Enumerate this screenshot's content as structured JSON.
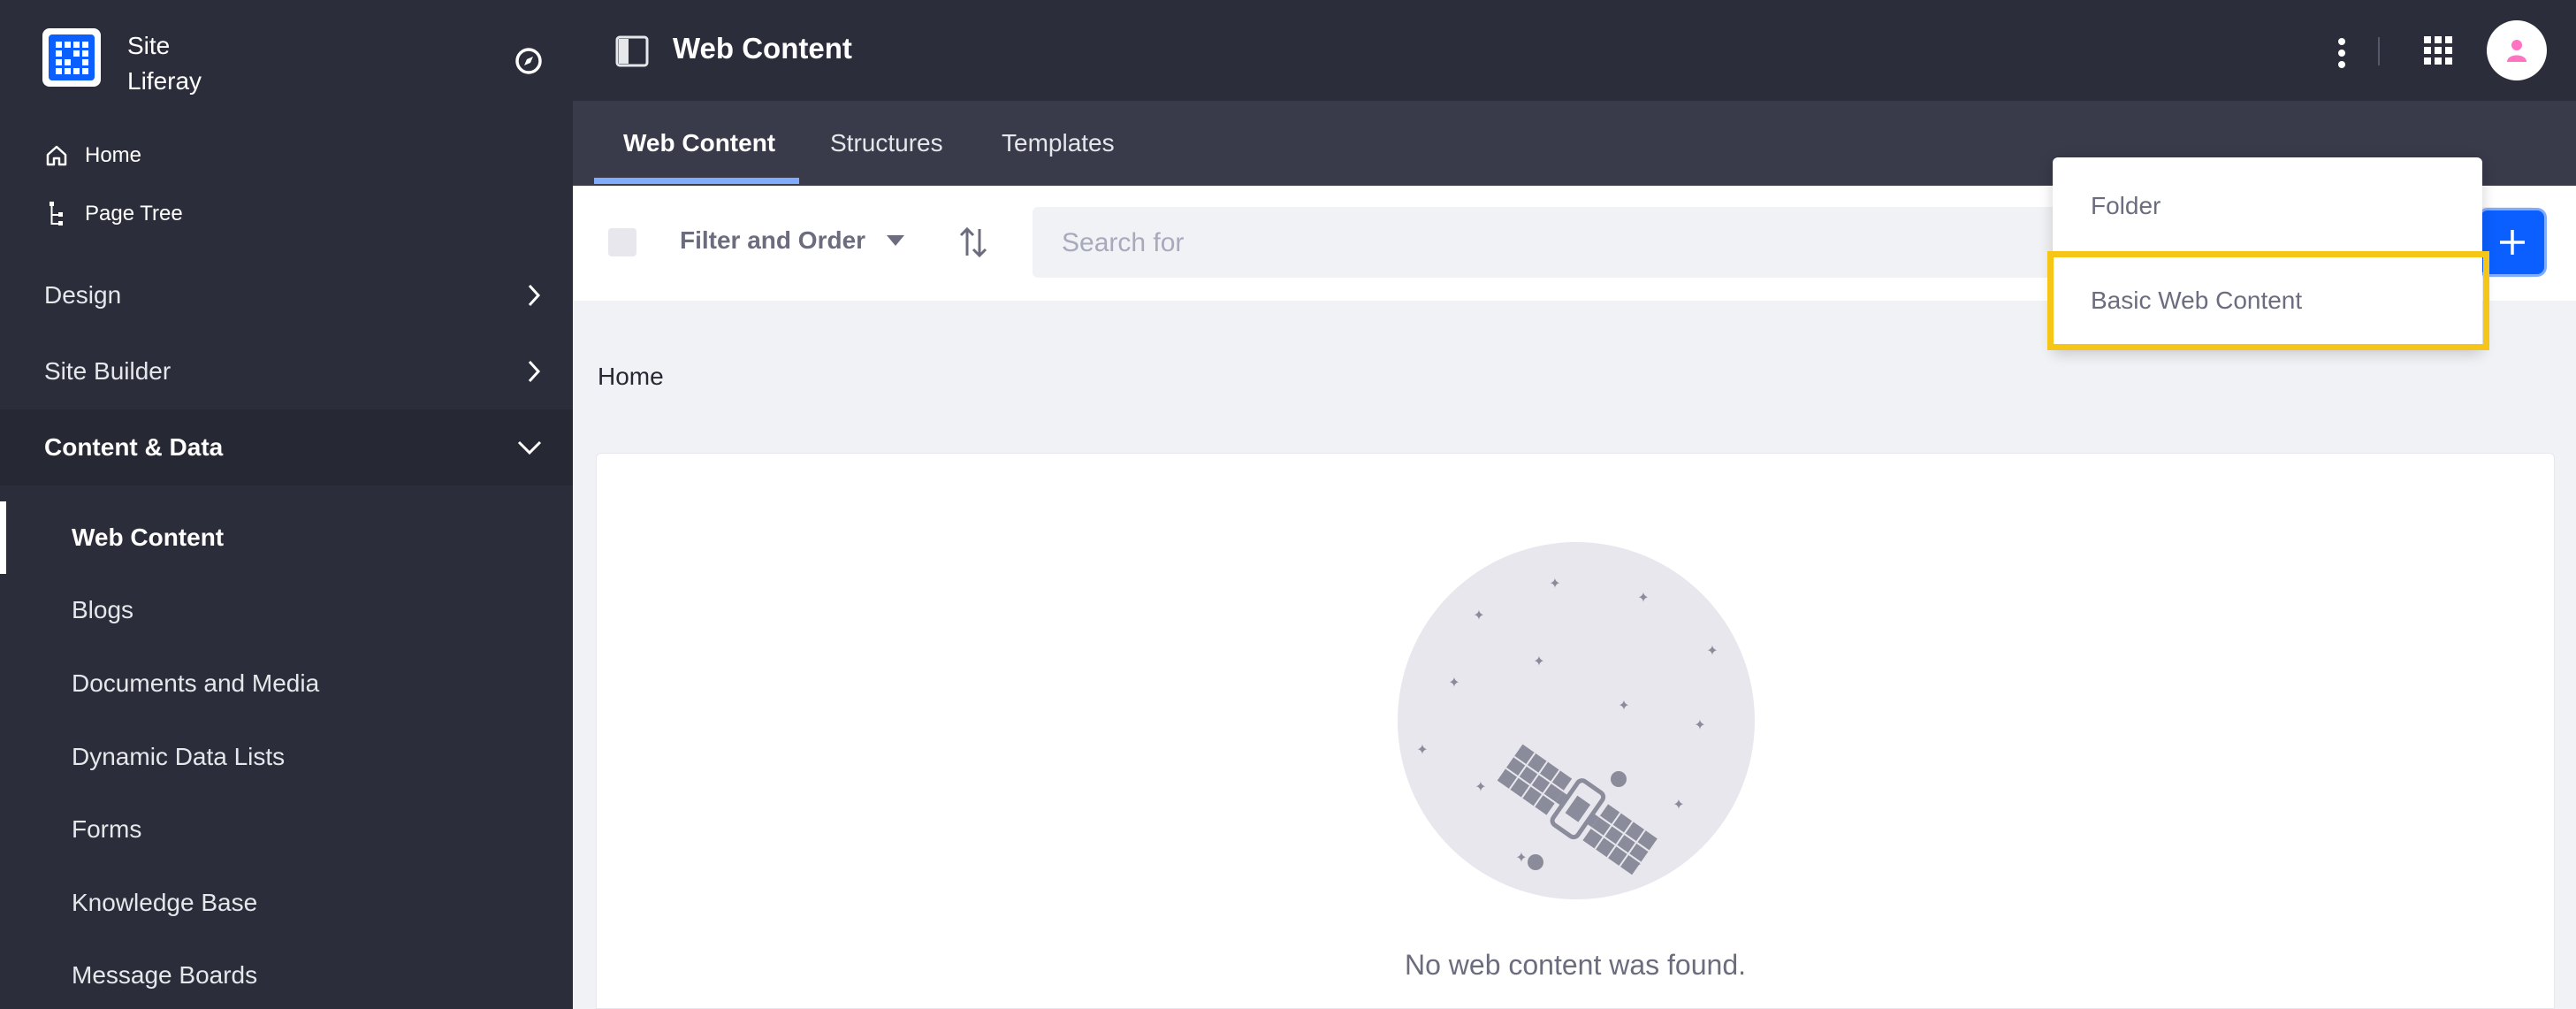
{
  "sidebar": {
    "site_label_1": "Site",
    "site_label_2": "Liferay",
    "nav": {
      "home": "Home",
      "page_tree": "Page Tree"
    },
    "sections": {
      "design": "Design",
      "site_builder": "Site Builder",
      "content_data": "Content & Data"
    },
    "content_items": [
      "Web Content",
      "Blogs",
      "Documents and Media",
      "Dynamic Data Lists",
      "Forms",
      "Knowledge Base",
      "Message Boards"
    ]
  },
  "header": {
    "title": "Web Content"
  },
  "tabs": [
    "Web Content",
    "Structures",
    "Templates"
  ],
  "toolbar": {
    "filter_label": "Filter and Order",
    "search_placeholder": "Search for"
  },
  "breadcrumb": "Home",
  "empty_state": {
    "message": "No web content was found."
  },
  "add_menu": {
    "items": [
      "Folder",
      "Basic Web Content"
    ]
  },
  "colors": {
    "sidebar_bg": "#2b2d3a",
    "tabbar_bg": "#393a4a",
    "primary": "#0b5fff",
    "highlight": "#f5c518",
    "tab_underline": "#80acff"
  }
}
